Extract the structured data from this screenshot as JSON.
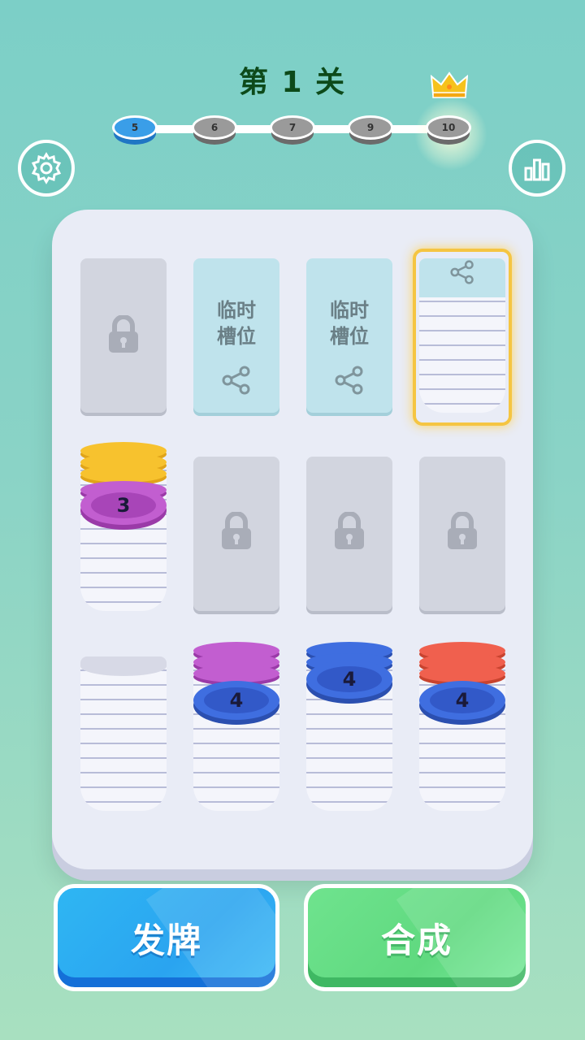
{
  "level": {
    "title": "第 1 关"
  },
  "progress": {
    "steps": [
      {
        "label": "5",
        "current": true
      },
      {
        "label": "6",
        "current": false
      },
      {
        "label": "7",
        "current": false
      },
      {
        "label": "9",
        "current": false
      },
      {
        "label": "10",
        "current": false
      }
    ]
  },
  "temp_slot": {
    "label_line1": "临时",
    "label_line2": "槽位"
  },
  "stacks": {
    "slot_r2c1": {
      "count": "3"
    },
    "slot_r3c2": {
      "count": "4"
    },
    "slot_r3c3": {
      "count": "4"
    },
    "slot_r3c4": {
      "count": "4"
    }
  },
  "buttons": {
    "deal": "发牌",
    "merge": "合成"
  },
  "colors": {
    "yellow": "#f7c22e",
    "purple": "#c25ed0",
    "blue": "#3f6ee0",
    "red": "#f0604e",
    "current_step": "#3a9ee8"
  },
  "icons": [
    "gear-icon",
    "stats-icon",
    "lock-icon",
    "share-icon",
    "crown-icon"
  ]
}
